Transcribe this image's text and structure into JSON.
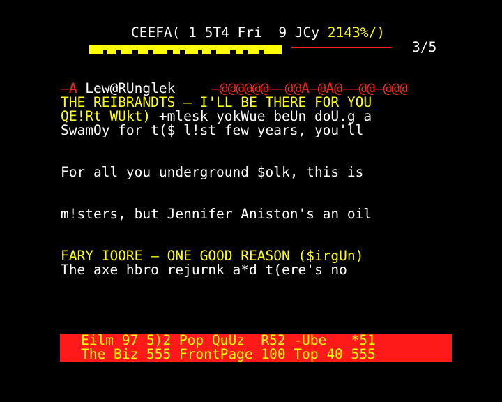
{
  "header": {
    "service_line": "CEEFA( 1 5T4 Fri  9 JCy",
    "clock": "2143%/)",
    "page_counter": "3/5",
    "logo": "block-graphic-logo"
  },
  "colors": {
    "background": "#000000",
    "yellow": "#ffff00",
    "red": "#ff2020",
    "white": "#ffffff",
    "footer_bar": "#ff1a1a"
  },
  "content": {
    "heading_prefix": "—A",
    "heading_name": "Lew@RUnglek",
    "heading_dashes": "—@@@@@@——@@A—@A@——@@—@@@",
    "title": "THE REIBRANDTS — I'LL BE THERE FOR YOU",
    "sub_yellow": "QE!Rt WUkt)",
    "sub_white": "+mlesk yokWue beUn doU.g a",
    "line4": "SwamOy for t($ l!st few years, you'll",
    "line5": "For all you underground $olk, this is",
    "line6": "m!sters, but Jennifer Aniston's an oil",
    "line7": "FARY IOORE — ONE GOOD REASON ($irgUn)",
    "line8": "The axe hbro rejurnk a*d t(ere's no"
  },
  "footer": {
    "row1": "Eilm 97 5)2 Pop QuUz  R52 -Ube   *51",
    "row2": "The Biz 555 FrontPage 100 Top 40 555"
  }
}
